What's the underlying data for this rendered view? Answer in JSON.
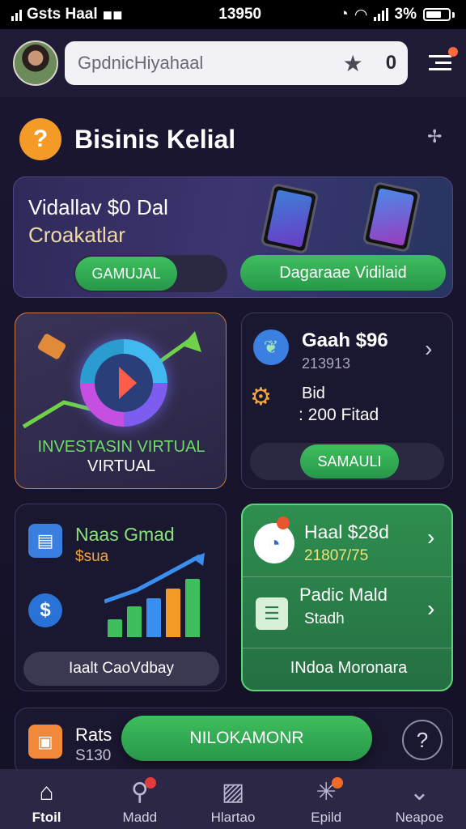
{
  "status_bar": {
    "carrier": "Gsts Haal",
    "time": "13950",
    "battery": "3%"
  },
  "header": {
    "search_text": "GpdnicHiyahaal",
    "mic_glyph": "0"
  },
  "section": {
    "badge_glyph": "?",
    "title": "Bisinis Kelial"
  },
  "promo": {
    "title_line1": "Vidallav $0 Dal",
    "title_line2": "Croakatlar",
    "button_left": "GAMUJAL",
    "button_right": "Dagaraae Vidilaid"
  },
  "invest": {
    "line1": "INVESTASIN VIRTUAL",
    "line2": "VIRTUAL"
  },
  "cash": {
    "title": "Gaah $96",
    "subtitle": "213913",
    "bid_label": "Bid",
    "bid_value": ": 200 Fitad",
    "button": "SAMAULI"
  },
  "net": {
    "title": "Naas Gmad",
    "subtitle": "$sua",
    "button": "Iaalt CaoVdbay"
  },
  "haal": {
    "title": "Haal $28d",
    "subtitle": "21807/75",
    "row2_title": "Padic Mald",
    "row2_sub": "Stadh",
    "footer": "INdoa Moronara"
  },
  "bottom_card": {
    "title": "Rats",
    "subtitle": "S130",
    "button": "NILOKAMONR",
    "help_glyph": "?"
  },
  "tabs": [
    {
      "label": "Ftoil",
      "icon": "home-icon"
    },
    {
      "label": "Madd",
      "icon": "search-icon"
    },
    {
      "label": "Hlartao",
      "icon": "edit-icon"
    },
    {
      "label": "Epild",
      "icon": "spark-icon"
    },
    {
      "label": "Neapoe",
      "icon": "chevron-down-icon"
    }
  ],
  "colors": {
    "accent_green": "#34b556",
    "accent_orange": "#f39a27",
    "bg": "#16132b"
  }
}
